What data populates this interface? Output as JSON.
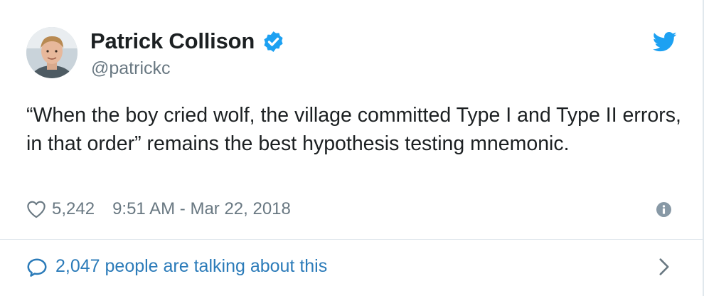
{
  "author": {
    "name": "Patrick Collison",
    "handle": "@patrickc",
    "verified": true
  },
  "tweet": {
    "text": "“When the boy cried wolf, the village committed Type I and Type II errors, in that order” remains the best hypothesis testing mnemonic.",
    "likes": "5,242",
    "timestamp": "9:51 AM - Mar 22, 2018"
  },
  "conversation": {
    "label": "2,047 people are talking about this"
  },
  "icons": {
    "brand": "twitter-bird-icon",
    "verified": "verified-badge-icon",
    "like": "heart-outline-icon",
    "info": "info-circle-icon",
    "conversation": "speech-bubble-icon",
    "chevron": "chevron-right-icon"
  },
  "colors": {
    "twitter_blue": "#1da1f2",
    "link_blue": "#2b7bb9",
    "text": "#1c2022",
    "muted": "#697882",
    "divider": "#e1e8ed"
  }
}
